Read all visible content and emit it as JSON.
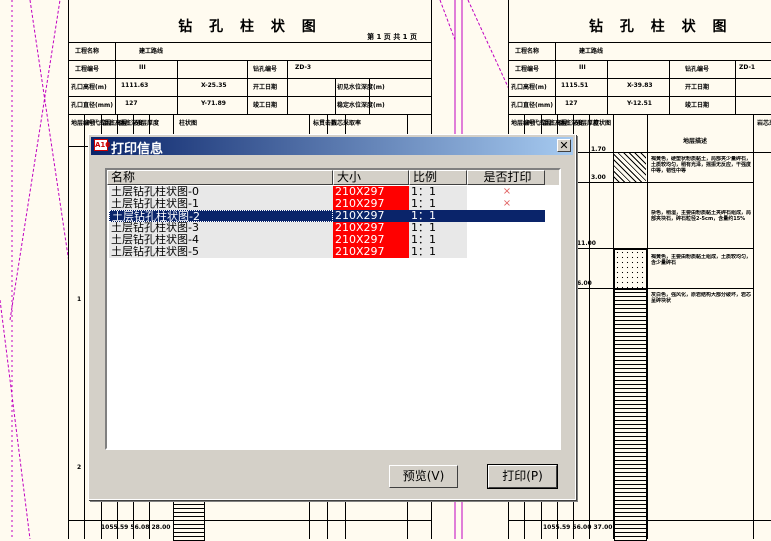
{
  "background_sheets": [
    {
      "title": "钻 孔 柱 状 图",
      "page_label": "第 1 页 共 1 页",
      "header_rows": [
        {
          "k1": "工程名称",
          "v1": "建工路线"
        },
        {
          "k1": "工程编号",
          "v1": "III",
          "k2": "钻孔编号",
          "v2": "ZD-3"
        },
        {
          "k1": "孔口高程(m)",
          "v1": "1111.63",
          "k2": "X-25.35",
          "k3": "初见水位深度(m)",
          "v3": "",
          "k4": "开工日期"
        },
        {
          "k1": "孔口直径(mm)",
          "v1": "127",
          "k2": "Y-71.89",
          "k3": "竣工日期",
          "k4": "稳定水位深度(m)"
        }
      ],
      "col_heads": [
        "地层编号",
        "时代成因",
        "层底高程",
        "层底深度",
        "分层厚度",
        "柱状图",
        "",
        "标贯击数",
        "岩芯采取率"
      ],
      "depth_marks": [
        "1",
        "2"
      ],
      "bottom_row": "1055.59 56.08 28.00"
    },
    {
      "title": "钻 孔 柱 状 图",
      "header_rows": [
        {
          "k1": "工程名称",
          "v1": "建工路线"
        },
        {
          "k1": "工程编号",
          "v1": "III",
          "k2": "钻孔编号",
          "v2": "ZD-1"
        },
        {
          "k1": "孔口高程(m)",
          "v1": "1115.51",
          "k2": "X-39.83",
          "k3": "开工日期"
        },
        {
          "k1": "孔口直径(mm)",
          "v1": "127",
          "k2": "Y-12.51",
          "k3": "竣工日期"
        }
      ],
      "col_heads": [
        "地层编号",
        "时代成因",
        "层底高程",
        "层底深度",
        "分层厚度",
        "柱状图",
        "地层描述",
        "岩芯采取率"
      ],
      "depth_values": [
        "1.70",
        "3.00",
        "11.00",
        "6.00"
      ],
      "descriptions": [
        "褐黄色，硬塑状粉质黏土，局部夹少量碎石，土质较均匀，稍有光泽，摇振无反应，干强度中等，韧性中等",
        "杂色，稍湿，主要由粉质黏土夹碎石组成，局部夹块石，碎石粒径2-5cm，含量约15%",
        "褐黄色，主要由粉质黏土组成，土质较均匀，含少量碎石",
        "灰白色，强风化，原岩结构大部分破坏，岩芯呈碎块状"
      ],
      "bottom_row": "1055.59 56.00 37.00"
    }
  ],
  "dialog": {
    "title": "打印信息",
    "app_icon": "A10",
    "close_icon": "✕",
    "columns": [
      "名称",
      "大小",
      "比例",
      "是否打印"
    ],
    "rows": [
      {
        "name": "土层钻孔柱状图-0",
        "size": "210X297",
        "ratio": "1：1",
        "print": "×",
        "selected": false
      },
      {
        "name": "土层钻孔柱状图-1",
        "size": "210X297",
        "ratio": "1：1",
        "print": "×",
        "selected": false
      },
      {
        "name": "土层钻孔柱状图-2",
        "size": "210X297",
        "ratio": "1：1",
        "print": "",
        "selected": true
      },
      {
        "name": "土层钻孔柱状图-3",
        "size": "210X297",
        "ratio": "1：1",
        "print": "",
        "selected": false
      },
      {
        "name": "土层钻孔柱状图-4",
        "size": "210X297",
        "ratio": "1：1",
        "print": "",
        "selected": false
      },
      {
        "name": "土层钻孔柱状图-5",
        "size": "210X297",
        "ratio": "1：1",
        "print": "",
        "selected": false
      }
    ],
    "preview_button": "预览(V)",
    "print_button": "打印(P)"
  },
  "colors": {
    "size_cell": "#ff0000",
    "selection": "#0a246a",
    "title_bar": "#0a246a",
    "page_bg": "#fffbf0",
    "guide_line": "#c000c0"
  }
}
